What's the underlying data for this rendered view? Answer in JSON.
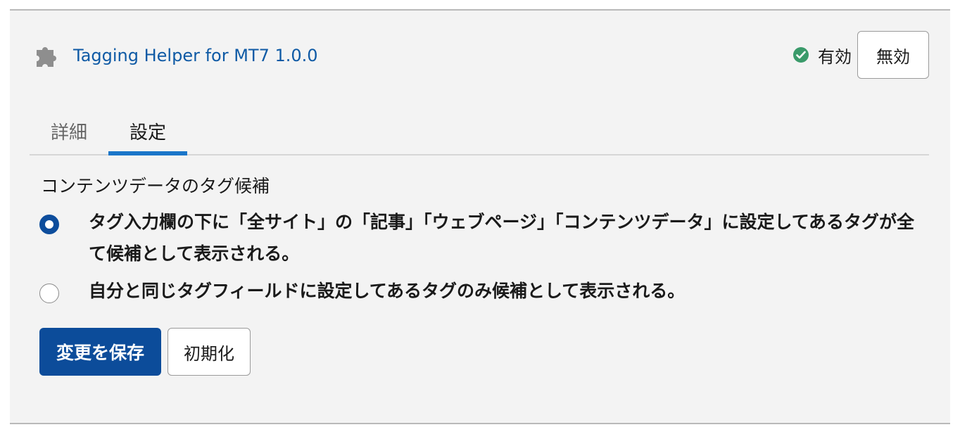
{
  "plugin": {
    "name": "Tagging Helper for MT7 1.0.0",
    "icon": "puzzle-icon",
    "status_icon": "check-circle-icon",
    "status_text": "有効",
    "disable_label": "無効"
  },
  "tabs": [
    {
      "label": "詳細",
      "active": false
    },
    {
      "label": "設定",
      "active": true
    }
  ],
  "settings": {
    "section_title": "コンテンツデータのタグ候補",
    "options": [
      {
        "label": "タグ入力欄の下に「全サイト」の「記事」「ウェブページ」「コンテンツデータ」に設定してあるタグが全て候補として表示される。",
        "checked": true
      },
      {
        "label": "自分と同じタグフィールドに設定してあるタグのみ候補として表示される。",
        "checked": false
      }
    ],
    "save_label": "変更を保存",
    "reset_label": "初期化"
  },
  "colors": {
    "link": "#0f5aa5",
    "primary": "#0c4c9a",
    "tab_active": "#1a76c9",
    "status_ok": "#3a9a6a"
  }
}
